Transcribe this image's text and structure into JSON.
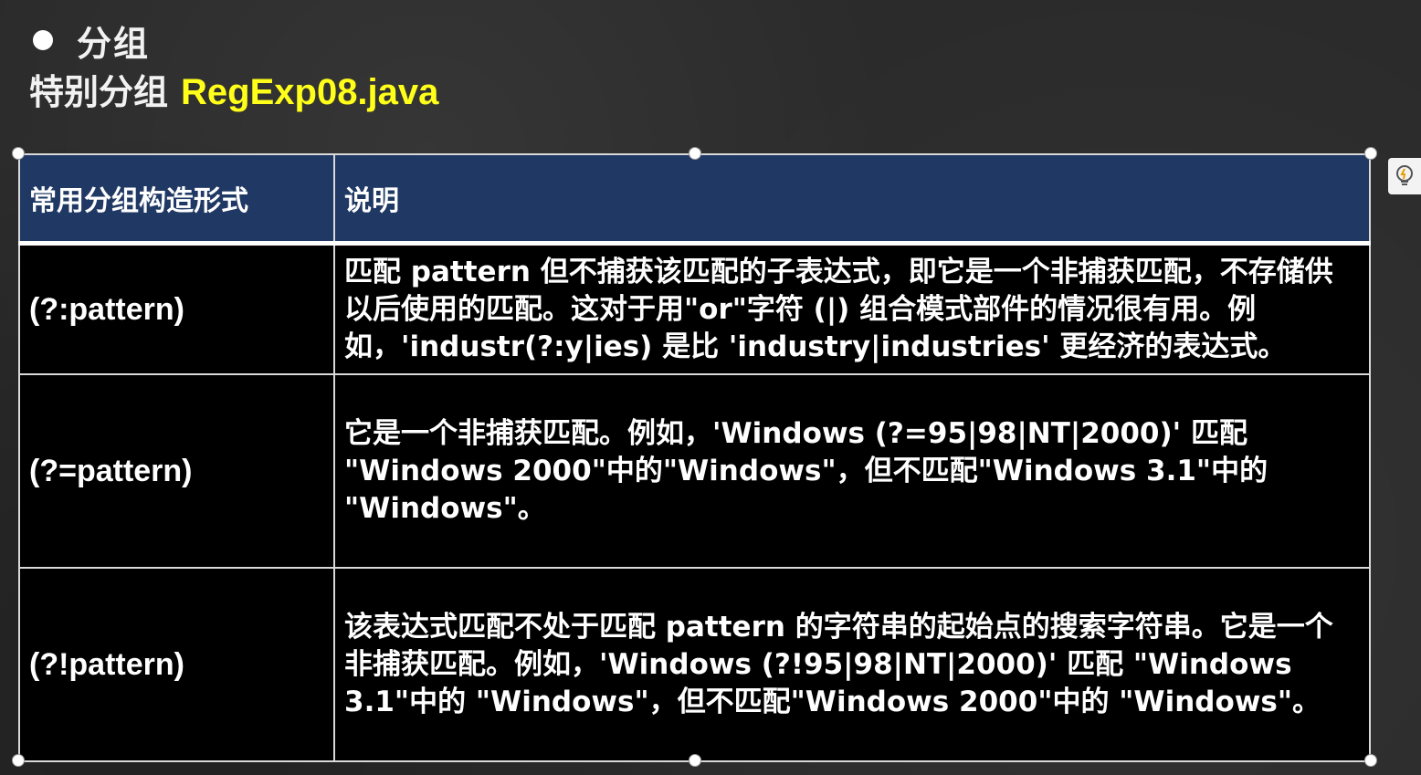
{
  "header": {
    "bullet_title": "分组",
    "subtitle_prefix": "特别分组",
    "file_name": "RegExp08.java",
    "file_name_color": "#ffff1a"
  },
  "table": {
    "header_bg": "#1f3864",
    "col1_header": "常用分组构造形式",
    "col2_header": "说明",
    "rows": [
      {
        "construct": "(?:pattern)",
        "description": "匹配 pattern 但不捕获该匹配的子表达式，即它是一个非捕获匹配，不存储供以后使用的匹配。这对于用\"or\"字符 (|) 组合模式部件的情况很有用。例如，'industr(?:y|ies) 是比 'industry|industries' 更经济的表达式。"
      },
      {
        "construct": "(?=pattern)",
        "description": "它是一个非捕获匹配。例如，'Windows (?=95|98|NT|2000)' 匹配 \"Windows 2000\"中的\"Windows\"，但不匹配\"Windows 3.1\"中的 \"Windows\"。"
      },
      {
        "construct": "(?!pattern)",
        "description": "该表达式匹配不处于匹配 pattern 的字符串的起始点的搜索字符串。它是一个非捕获匹配。例如，'Windows (?!95|98|NT|2000)' 匹配 \"Windows 3.1\"中的 \"Windows\"，但不匹配\"Windows 2000\"中的 \"Windows\"。"
      }
    ]
  },
  "side_button": {
    "icon": "lightbulb-icon"
  }
}
